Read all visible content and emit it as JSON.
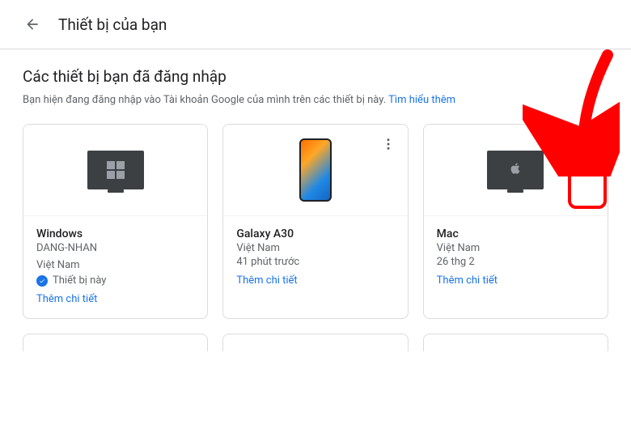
{
  "header": {
    "title": "Thiết bị của bạn"
  },
  "section": {
    "title": "Các thiết bị bạn đã đăng nhập",
    "description": "Bạn hiện đang đăng nhập vào Tài khoản Google của mình trên các thiết bị này. ",
    "learn_more": "Tìm hiểu thêm"
  },
  "devices": [
    {
      "name": "Windows",
      "subtitle": "DANG-NHAN",
      "location": "Việt Nam",
      "this_device_label": "Thiết bị này",
      "details": "Thêm chi tiết"
    },
    {
      "name": "Galaxy A30",
      "location": "Việt Nam",
      "time": "41 phút trước",
      "details": "Thêm chi tiết"
    },
    {
      "name": "Mac",
      "location": "Việt Nam",
      "time": "26 thg 2",
      "details": "Thêm chi tiết"
    }
  ]
}
